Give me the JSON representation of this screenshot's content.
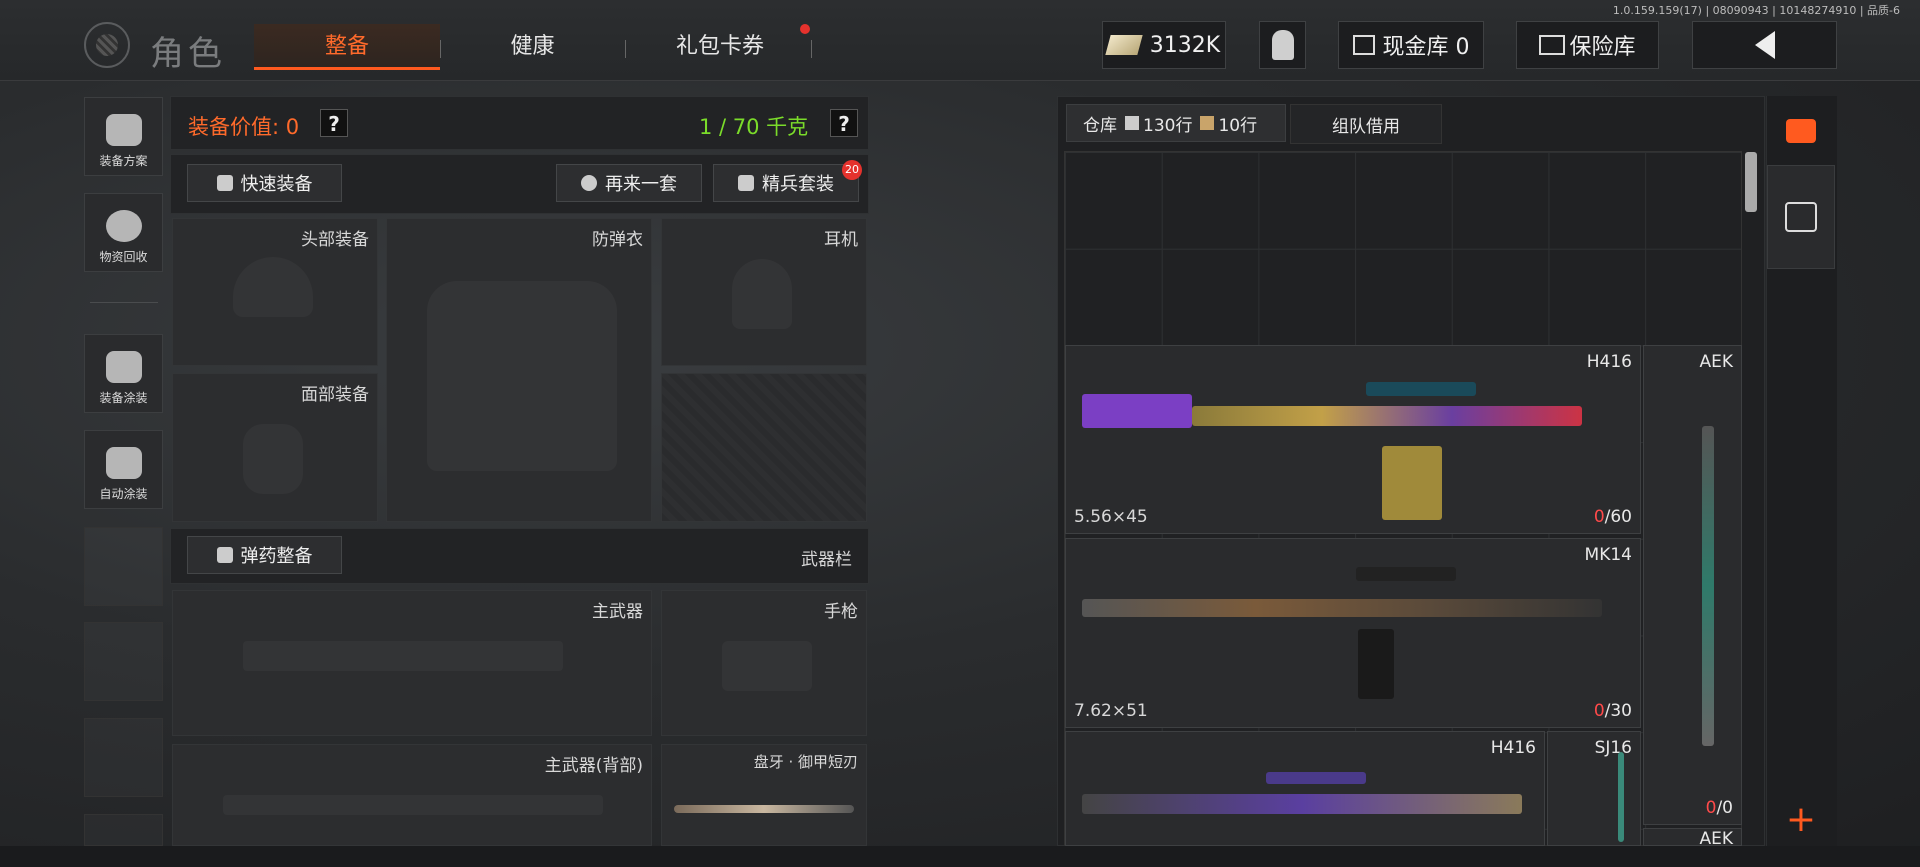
{
  "version": "1.0.159.159(17) | 08090943 | 10148274910 | 品质-6",
  "header": {
    "title": "角色",
    "tabs": [
      {
        "label": "整备",
        "active": true
      },
      {
        "label": "健康",
        "active": false
      },
      {
        "label": "礼包卡券",
        "active": false,
        "notification": true
      }
    ],
    "money": "3132K",
    "cash_vault": "现金库 0",
    "safe": "保险库"
  },
  "sidebar": {
    "items": [
      {
        "label": "装备方案",
        "icon": "helmet-grid-icon"
      },
      {
        "label": "物资回收",
        "icon": "recycle-face-icon"
      },
      {
        "label": "装备涂装",
        "icon": "helmet-paint-icon"
      },
      {
        "label": "自动涂装",
        "icon": "brush-gear-icon"
      }
    ]
  },
  "equipment": {
    "value_label": "装备价值: 0",
    "weight": "1 / 70 千克",
    "quick_equip": "快速装备",
    "again": "再来一套",
    "elite_set": "精兵套装",
    "elite_badge": "20",
    "slots": {
      "head": "头部装备",
      "vest": "防弹衣",
      "headset": "耳机",
      "face": "面部装备",
      "ammo_btn": "弹药整备",
      "weapon_bar": "武器栏",
      "primary": "主武器",
      "pistol": "手枪",
      "primary_back": "主武器(背部)",
      "melee": "盘牙 · 御甲短刃"
    }
  },
  "warehouse": {
    "tab_label": "仓库",
    "home_rows": "130行",
    "ticket_rows": "10行",
    "team_borrow": "组队借用",
    "weapons": [
      {
        "name": "H416",
        "ammo": "5.56×45",
        "count_zero": "0",
        "count_total": "/60"
      },
      {
        "name": "MK14",
        "ammo": "7.62×51",
        "count_zero": "0",
        "count_total": "/30"
      },
      {
        "name": "H416",
        "ammo": "",
        "count_zero": "",
        "count_total": ""
      },
      {
        "name": "SJ16",
        "ammo": "",
        "count_zero": "",
        "count_total": ""
      },
      {
        "name": "AEK",
        "ammo": "",
        "count_zero": "0",
        "count_total": "/0"
      },
      {
        "name": "AEK",
        "ammo": "",
        "count_zero": "",
        "count_total": ""
      }
    ]
  },
  "colors": {
    "accent": "#ff5a1f",
    "weight_green": "#7bdc2a",
    "alert_red": "#e5322d"
  }
}
